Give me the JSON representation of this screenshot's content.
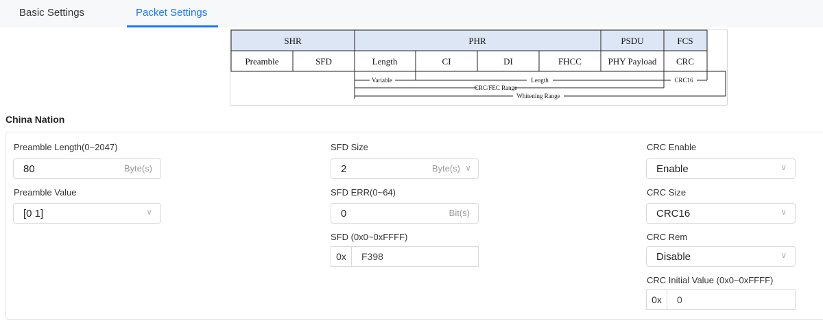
{
  "tabs": [
    {
      "label": "Basic Settings",
      "active": false
    },
    {
      "label": "Packet Settings",
      "active": true
    }
  ],
  "diagram": {
    "headers": [
      "SHR",
      "PHR",
      "PSDU",
      "FCS"
    ],
    "fields": [
      "Preamble",
      "SFD",
      "Length",
      "CI",
      "DI",
      "FHCC",
      "PHY Payload",
      "CRC"
    ],
    "ranges": {
      "variable": "Variable",
      "length": "Length",
      "crc16": "CRC16",
      "crc_fec": "CRC/FEC Range",
      "whitening": "Whitening Range"
    }
  },
  "section": {
    "title": "China Nation"
  },
  "preamble": {
    "length_label": "Preamble Length(0~2047)",
    "length_value": "80",
    "length_unit": "Byte(s)",
    "value_label": "Preamble Value",
    "value": "[0 1]"
  },
  "sfd": {
    "size_label": "SFD Size",
    "size_value": "2",
    "size_unit": "Byte(s)",
    "err_label": "SFD ERR(0~64)",
    "err_value": "0",
    "err_unit": "Bit(s)",
    "sfd_label": "SFD (0x0~0xFFFF)",
    "sfd_prefix": "0x",
    "sfd_value": "F398"
  },
  "crc": {
    "enable_label": "CRC Enable",
    "enable_value": "Enable",
    "size_label": "CRC Size",
    "size_value": "CRC16",
    "rem_label": "CRC Rem",
    "rem_value": "Disable",
    "init_label": "CRC Initial Value (0x0~0xFFFF)",
    "init_prefix": "0x",
    "init_value": "0"
  },
  "colors": {
    "accent": "#1677ff",
    "tab_bg": "#f7f8fa",
    "header_bg": "#dde6f5"
  }
}
